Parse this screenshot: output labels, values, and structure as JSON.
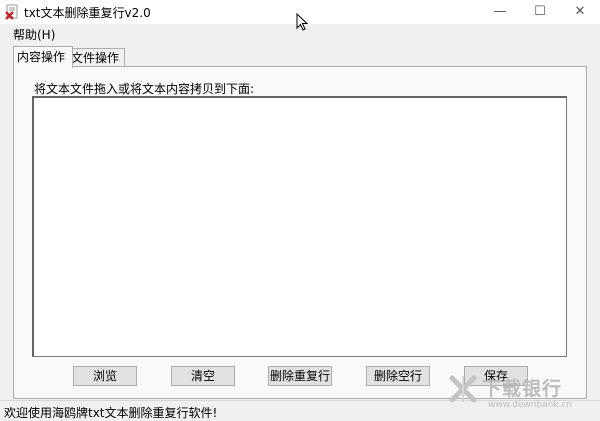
{
  "window": {
    "title": "txt文本删除重复行v2.0",
    "controls": {
      "minimize": "—",
      "maximize": "☐",
      "close": "✕"
    }
  },
  "menu": {
    "help": "帮助(H)"
  },
  "tabs": [
    {
      "label": "内容操作",
      "active": true
    },
    {
      "label": "文件操作",
      "active": false
    }
  ],
  "content": {
    "drop_label": "将文本文件拖入或将文本内容拷贝到下面:",
    "textarea_value": ""
  },
  "buttons": {
    "browse": "浏览",
    "clear": "清空",
    "remove_duplicates": "删除重复行",
    "remove_blank": "删除空行",
    "save": "保存"
  },
  "status": {
    "text": "欢迎使用海鸥牌txt文本删除重复行软件!"
  },
  "watermark": {
    "brand": "下载银行",
    "url": "www.downbank.cn",
    "color": "#bcbcbc"
  },
  "colors": {
    "window_bg": "#f0f0f0",
    "panel_bg": "#f9f9f9",
    "button_bg": "#e1e1e1",
    "border": "#adadad"
  }
}
